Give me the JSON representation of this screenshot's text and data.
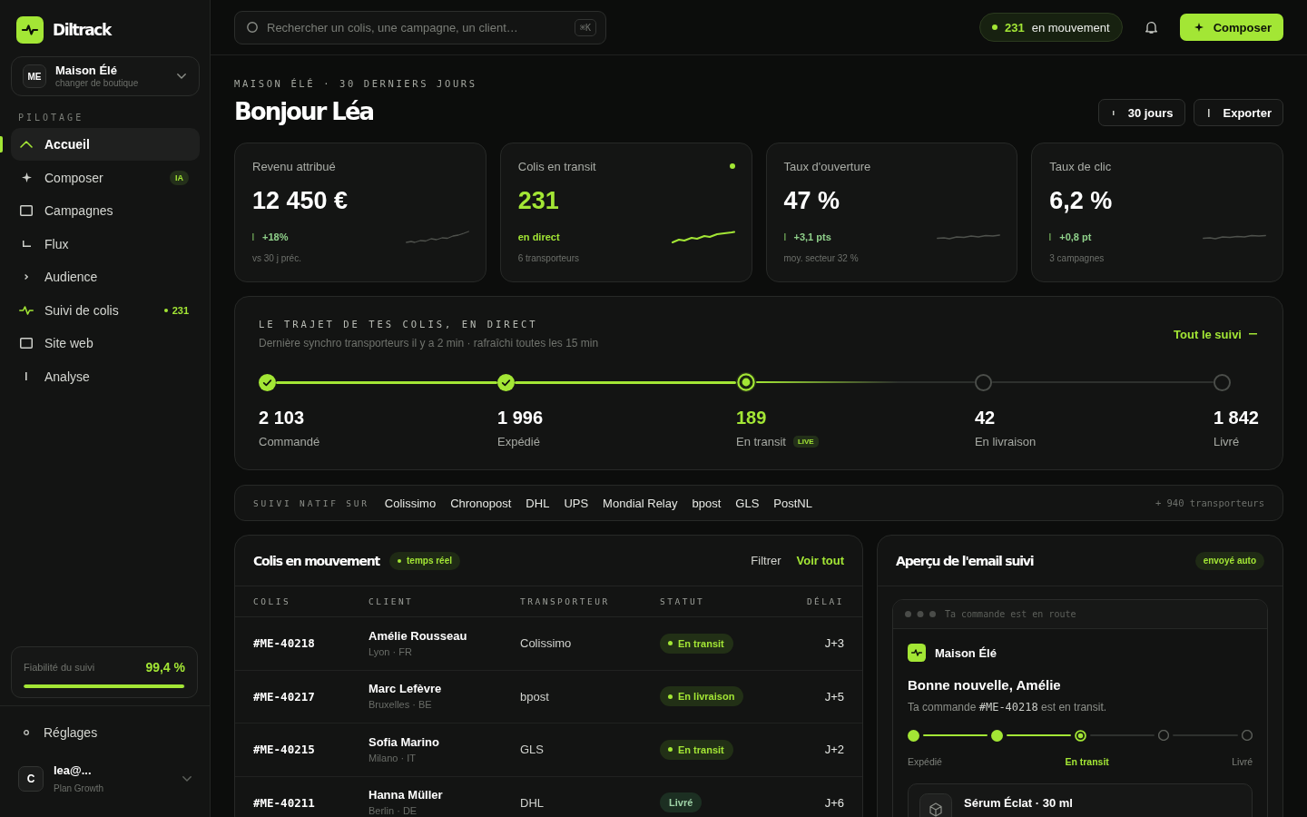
{
  "sidebar": {
    "brand": {
      "name": "Diltrack"
    },
    "shop": {
      "initials": "ME",
      "name": "Maison Élé",
      "hint": "changer de boutique"
    },
    "section_label": "PILOTAGE",
    "nav_items": [
      {
        "label": "Accueil",
        "selected": true
      },
      {
        "label": "Composer",
        "selected": false,
        "badge": {
          "text": "IA",
          "kind": "tag"
        }
      },
      {
        "label": "Campagnes",
        "selected": false
      },
      {
        "label": "Flux",
        "selected": false
      },
      {
        "label": "Audience",
        "selected": false
      },
      {
        "label": "Suivi de colis",
        "selected": false,
        "badge": {
          "text": "231",
          "kind": "live"
        }
      },
      {
        "label": "Site web",
        "selected": false
      },
      {
        "label": "Analyse",
        "selected": false
      }
    ],
    "reliability": {
      "label": "Fiabilité du suivi",
      "value": "99,4 %",
      "level": 0.994
    },
    "settings": {
      "label": "Réglages"
    },
    "user": {
      "initial": "C",
      "email": "lea@...",
      "plan": "Plan Growth"
    }
  },
  "topbar": {
    "search": {
      "placeholder": "Rechercher un colis, une campagne, un client…",
      "shortcut": "⌘K"
    },
    "live_pill": {
      "count": "231",
      "label": "en mouvement"
    },
    "compose_button": {
      "label": "Composer"
    }
  },
  "header": {
    "eyebrow": "MAISON ÉLÉ · 30 DERNIERS JOURS",
    "title": "Bonjour Léa",
    "buttons": [
      "30 jours",
      "Exporter"
    ]
  },
  "kpis": [
    {
      "label": "Revenu attribué",
      "value": "12 450 €",
      "delta": "+18%",
      "note": "vs 30 j préc.",
      "live": false
    },
    {
      "label": "Colis en transit",
      "value": "231",
      "delta": "en direct",
      "note": "6 transporteurs",
      "live": true
    },
    {
      "label": "Taux d'ouverture",
      "value": "47 %",
      "delta": "+3,1 pts",
      "note": "moy. secteur 32 %",
      "live": false
    },
    {
      "label": "Taux de clic",
      "value": "6,2 %",
      "delta": "+0,8 pt",
      "note": "3 campagnes",
      "live": false
    }
  ],
  "journey": {
    "eyebrow": "LE TRAJET DE TES COLIS, EN DIRECT",
    "subtitle": "Dernière synchro transporteurs il y a 2 min · rafraîchi toutes les 15 min",
    "link": "Tout le suivi",
    "steps": [
      {
        "count": "2 103",
        "label": "Commandé",
        "kind": "done"
      },
      {
        "count": "1 996",
        "label": "Expédié",
        "kind": "done"
      },
      {
        "count": "189",
        "label": "En transit",
        "kind": "current",
        "badge": "LIVE"
      },
      {
        "count": "42",
        "label": "En livraison",
        "kind": "pending"
      },
      {
        "count": "1 842",
        "label": "Livré",
        "kind": "pending"
      }
    ]
  },
  "carriers": {
    "label": "SUIVI NATIF SUR",
    "items": [
      "Colissimo",
      "Chronopost",
      "DHL",
      "UPS",
      "Mondial Relay",
      "bpost",
      "GLS",
      "PostNL"
    ],
    "more": "+ 940 transporteurs"
  },
  "shipments": {
    "title": "Colis en mouvement",
    "live_badge": "temps réel",
    "filter": "Filtrer",
    "view_all": "Voir tout",
    "columns": [
      "COLIS",
      "CLIENT",
      "TRANSPORTEUR",
      "STATUT",
      "DÉLAI"
    ],
    "rows": [
      {
        "id": "#ME-40218",
        "client": "Amélie Rousseau",
        "location": "Lyon · FR",
        "carrier": "Colissimo",
        "status": {
          "text": "En transit",
          "kind": "active"
        },
        "delay": "J+3"
      },
      {
        "id": "#ME-40217",
        "client": "Marc Lefèvre",
        "location": "Bruxelles · BE",
        "carrier": "bpost",
        "status": {
          "text": "En livraison",
          "kind": "active"
        },
        "delay": "J+5"
      },
      {
        "id": "#ME-40215",
        "client": "Sofia Marino",
        "location": "Milano · IT",
        "carrier": "GLS",
        "status": {
          "text": "En transit",
          "kind": "active"
        },
        "delay": "J+2"
      },
      {
        "id": "#ME-40211",
        "client": "Hanna Müller",
        "location": "Berlin · DE",
        "carrier": "DHL",
        "status": {
          "text": "Livré",
          "kind": "done"
        },
        "delay": "J+6"
      }
    ]
  },
  "email_preview": {
    "title": "Aperçu de l'email suivi",
    "badge": "envoyé auto",
    "subject": "Ta commande est en route",
    "brand": "Maison Élé",
    "heading": "Bonne nouvelle, Amélie",
    "message": {
      "before": "Ta commande ",
      "order": "#ME-40218",
      "after": " est en transit."
    },
    "steps": [
      {
        "kind": "done"
      },
      {
        "kind": "done"
      },
      {
        "kind": "current"
      },
      {
        "kind": "pending"
      },
      {
        "kind": "pending"
      }
    ],
    "step_labels": [
      {
        "text": "Expédié",
        "active": false
      },
      {
        "text": "En transit",
        "active": true
      },
      {
        "text": "Livré",
        "active": false
      }
    ],
    "product": {
      "name": "Sérum Éclat · 30 ml"
    }
  }
}
